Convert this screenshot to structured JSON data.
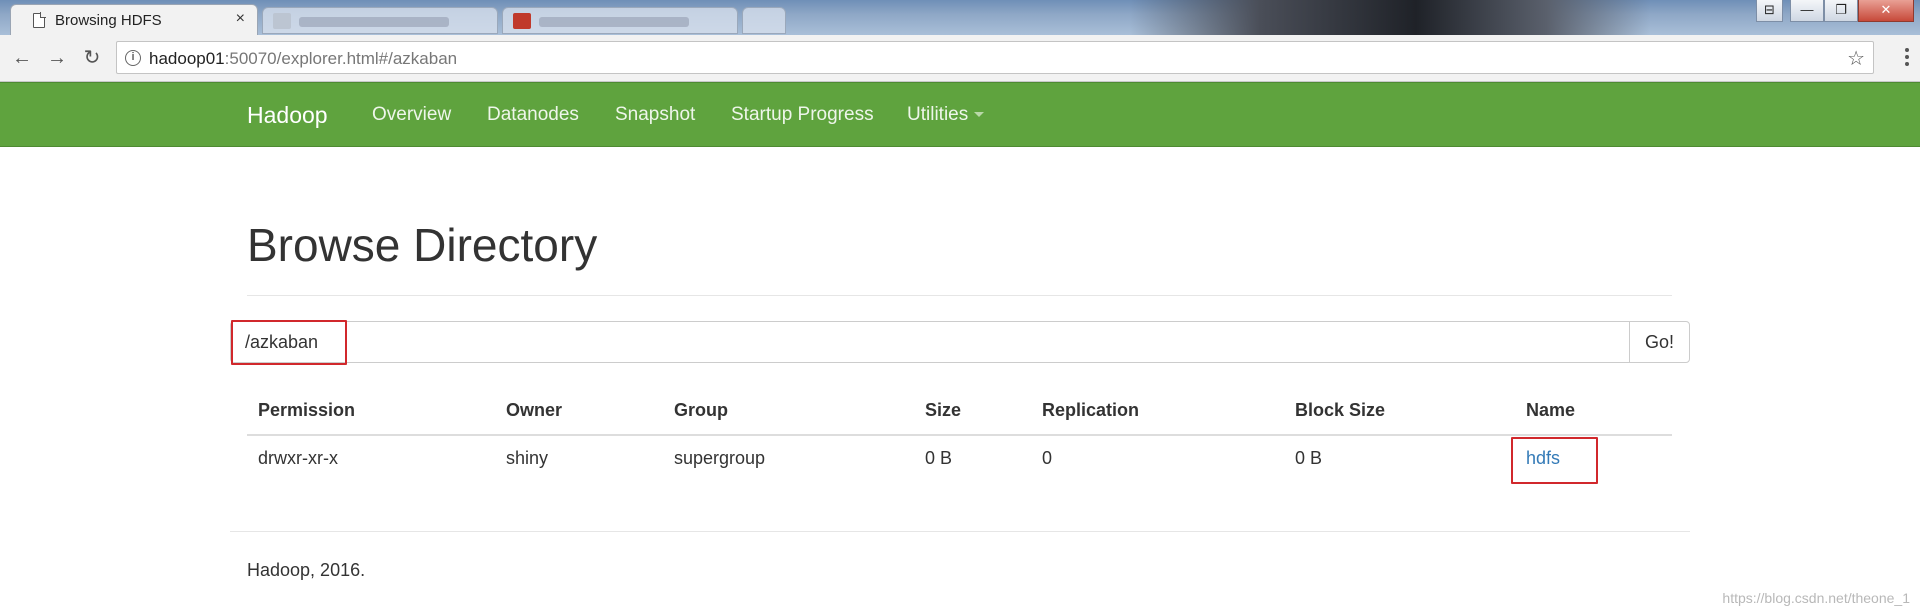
{
  "browser": {
    "active_tab_title": "Browsing HDFS",
    "tab_close": "×",
    "url_host": "hadoop01",
    "url_rest": ":50070/explorer.html#/azkaban",
    "win_controls": [
      "⊟",
      "—",
      "❐",
      "✕"
    ]
  },
  "navbar": {
    "brand": "Hadoop",
    "items": [
      "Overview",
      "Datanodes",
      "Snapshot",
      "Startup Progress",
      "Utilities"
    ],
    "bg_color": "#5fa33e"
  },
  "page": {
    "title": "Browse Directory",
    "path_value": "/azkaban",
    "go_label": "Go!"
  },
  "table": {
    "headers": [
      "Permission",
      "Owner",
      "Group",
      "Size",
      "Replication",
      "Block Size",
      "Name"
    ],
    "rows": [
      [
        "drwxr-xr-x",
        "shiny",
        "supergroup",
        "0 B",
        "0",
        "0 B",
        "hdfs"
      ]
    ]
  },
  "footer": "Hadoop, 2016.",
  "watermark": "https://blog.csdn.net/theone_1",
  "highlight_color": "#d1282c",
  "link_color": "#337ab7"
}
